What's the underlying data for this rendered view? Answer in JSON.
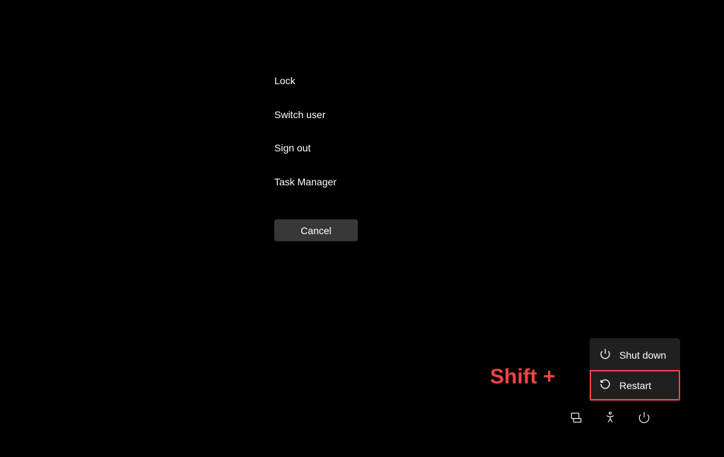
{
  "security_menu": {
    "items": [
      {
        "label": "Lock"
      },
      {
        "label": "Switch user"
      },
      {
        "label": "Sign out"
      },
      {
        "label": "Task Manager"
      }
    ],
    "cancel_label": "Cancel"
  },
  "annotation": {
    "text": "Shift +"
  },
  "power_menu": {
    "items": [
      {
        "label": "Shut down",
        "icon": "power-icon",
        "highlighted": false
      },
      {
        "label": "Restart",
        "icon": "restart-icon",
        "highlighted": true
      }
    ]
  },
  "bottom_bar": {
    "icons": [
      {
        "name": "network-icon"
      },
      {
        "name": "accessibility-icon"
      },
      {
        "name": "power-icon"
      }
    ]
  },
  "colors": {
    "background": "#000000",
    "button_bg": "#383838",
    "menu_bg": "#202020",
    "highlight": "#ef4444",
    "text": "#ffffff"
  }
}
